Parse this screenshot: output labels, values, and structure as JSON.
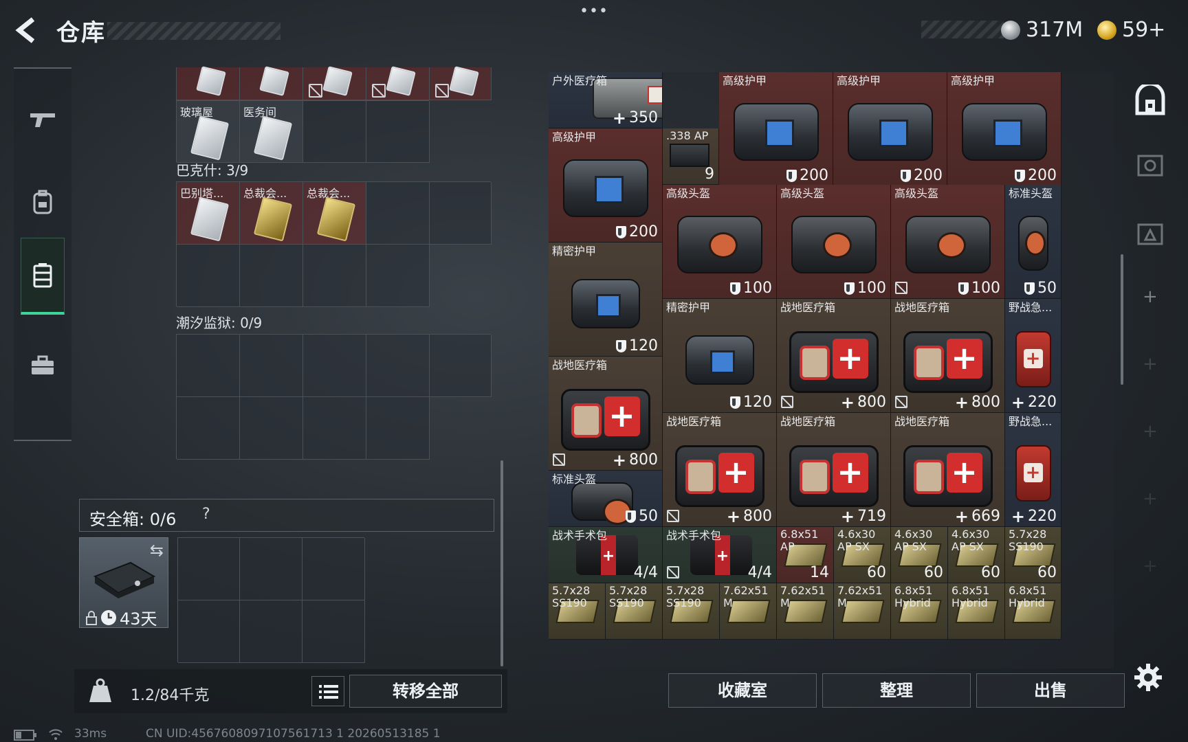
{
  "header": {
    "title": "仓库",
    "currencies": [
      {
        "icon": "silver-coin-icon",
        "amount": "317M"
      },
      {
        "icon": "gold-coin-icon",
        "amount": "59+"
      }
    ]
  },
  "stash": {
    "top_row_labels": [
      "玻璃屋",
      "医务间"
    ],
    "section_bakeshi": {
      "title": "巴克什: 3/9",
      "cards": [
        "巴别塔...",
        "总裁会...",
        "总裁会..."
      ]
    },
    "section_prison": {
      "title": "潮汐监狱: 0/9"
    },
    "safebox": {
      "title": "安全箱: 0/6",
      "help": "?",
      "days": "43天"
    },
    "weight": "1.2/84千克",
    "transfer_all": "转移全部"
  },
  "inventory": {
    "items": [
      {
        "name": "户外医疗箱",
        "value": "350",
        "kind": "heal"
      },
      {
        "name": "高级护甲",
        "value": "200",
        "kind": "armor"
      },
      {
        "name": "高级护甲",
        "value": "200",
        "kind": "armor"
      },
      {
        "name": "高级护甲",
        "value": "200",
        "kind": "armor"
      },
      {
        "name": "高级护甲",
        "value": "200",
        "kind": "armor"
      },
      {
        "name": ".338 AP",
        "value": "9",
        "kind": "ammo"
      },
      {
        "name": "高级头盔",
        "value": "100",
        "kind": "armor"
      },
      {
        "name": "高级头盔",
        "value": "100",
        "kind": "armor"
      },
      {
        "name": "高级头盔",
        "value": "100",
        "kind": "armor"
      },
      {
        "name": "标准头盔",
        "value": "50",
        "kind": "armor"
      },
      {
        "name": "精密护甲",
        "value": "120",
        "kind": "armor"
      },
      {
        "name": "精密护甲",
        "value": "120",
        "kind": "armor"
      },
      {
        "name": "战地医疗箱",
        "value": "800",
        "kind": "heal"
      },
      {
        "name": "战地医疗箱",
        "value": "800",
        "kind": "heal"
      },
      {
        "name": "野战急...",
        "value": "220",
        "kind": "heal"
      },
      {
        "name": "战地医疗箱",
        "value": "800",
        "kind": "heal"
      },
      {
        "name": "战地医疗箱",
        "value": "800",
        "kind": "heal"
      },
      {
        "name": "战地医疗箱",
        "value": "719",
        "kind": "heal"
      },
      {
        "name": "战地医疗箱",
        "value": "669",
        "kind": "heal"
      },
      {
        "name": "野战急...",
        "value": "220",
        "kind": "heal"
      },
      {
        "name": "标准头盔",
        "value": "50",
        "kind": "armor"
      },
      {
        "name": "战术手术包",
        "value": "4/4",
        "kind": "count"
      },
      {
        "name": "战术手术包",
        "value": "4/4",
        "kind": "count"
      },
      {
        "name": "6.8x51 AP",
        "value": "14",
        "kind": "count"
      },
      {
        "name": "4.6x30 AP SX",
        "value": "60",
        "kind": "count"
      },
      {
        "name": "4.6x30 AP SX",
        "value": "60",
        "kind": "count"
      },
      {
        "name": "4.6x30 AP SX",
        "value": "60",
        "kind": "count"
      },
      {
        "name": "5.7x28 SS190",
        "value": "60",
        "kind": "count"
      }
    ],
    "bottom_row": [
      "5.7x28 SS190",
      "5.7x28 SS190",
      "5.7x28 SS190",
      "7.62x51 M",
      "7.62x51 M",
      "7.62x51 M",
      "6.8x51 Hybrid",
      "6.8x51 Hybrid",
      "6.8x51 Hybrid"
    ]
  },
  "buttons": {
    "collection": "收藏室",
    "organize": "整理",
    "sell": "出售"
  },
  "status": {
    "ping": "33ms",
    "uid": "CN UID:4567608097107561713 1 20260513185 1"
  }
}
